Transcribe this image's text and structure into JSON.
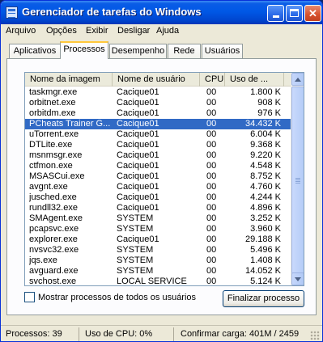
{
  "window": {
    "title": "Gerenciador de tarefas do Windows"
  },
  "menu": [
    "Arquivo",
    "Opções",
    "Exibir",
    "Desligar",
    "Ajuda"
  ],
  "tabs": [
    "Aplicativos",
    "Processos",
    "Desempenho",
    "Rede",
    "Usuários"
  ],
  "active_tab": "Processos",
  "list": {
    "columns": [
      "Nome da imagem",
      "Nome de usuário",
      "CPU",
      "Uso de ..."
    ],
    "rows": [
      {
        "name": "taskmgr.exe",
        "user": "Cacique01",
        "cpu": "00",
        "mem": "1.800 K"
      },
      {
        "name": "orbitnet.exe",
        "user": "Cacique01",
        "cpu": "00",
        "mem": "908 K"
      },
      {
        "name": "orbitdm.exe",
        "user": "Cacique01",
        "cpu": "00",
        "mem": "976 K"
      },
      {
        "name": "PCheats Trainer G...",
        "user": "Cacique01",
        "cpu": "00",
        "mem": "34.432 K",
        "selected": true
      },
      {
        "name": "uTorrent.exe",
        "user": "Cacique01",
        "cpu": "00",
        "mem": "6.004 K"
      },
      {
        "name": "DTLite.exe",
        "user": "Cacique01",
        "cpu": "00",
        "mem": "9.368 K"
      },
      {
        "name": "msnmsgr.exe",
        "user": "Cacique01",
        "cpu": "00",
        "mem": "9.220 K"
      },
      {
        "name": "ctfmon.exe",
        "user": "Cacique01",
        "cpu": "00",
        "mem": "4.548 K"
      },
      {
        "name": "MSASCui.exe",
        "user": "Cacique01",
        "cpu": "00",
        "mem": "8.752 K"
      },
      {
        "name": "avgnt.exe",
        "user": "Cacique01",
        "cpu": "00",
        "mem": "4.760 K"
      },
      {
        "name": "jusched.exe",
        "user": "Cacique01",
        "cpu": "00",
        "mem": "4.244 K"
      },
      {
        "name": "rundll32.exe",
        "user": "Cacique01",
        "cpu": "00",
        "mem": "4.896 K"
      },
      {
        "name": "SMAgent.exe",
        "user": "SYSTEM",
        "cpu": "00",
        "mem": "3.252 K"
      },
      {
        "name": "pcapsvc.exe",
        "user": "SYSTEM",
        "cpu": "00",
        "mem": "3.960 K"
      },
      {
        "name": "explorer.exe",
        "user": "Cacique01",
        "cpu": "00",
        "mem": "29.188 K"
      },
      {
        "name": "nvsvc32.exe",
        "user": "SYSTEM",
        "cpu": "00",
        "mem": "5.496 K"
      },
      {
        "name": "jqs.exe",
        "user": "SYSTEM",
        "cpu": "00",
        "mem": "1.408 K"
      },
      {
        "name": "avguard.exe",
        "user": "SYSTEM",
        "cpu": "00",
        "mem": "14.052 K"
      },
      {
        "name": "svchost.exe",
        "user": "LOCAL SERVICE",
        "cpu": "00",
        "mem": "5.124 K"
      }
    ]
  },
  "show_all_processes": {
    "label": "Mostrar processos de todos os usuários",
    "checked": false
  },
  "end_process_label": "Finalizar processo",
  "status": {
    "processes": "Processos: 39",
    "cpu": "Uso de CPU: 0%",
    "commit": "Confirmar carga: 401M / 2459"
  },
  "colors": {
    "selection": "#316ac5",
    "titlebar": "#0058e6"
  }
}
